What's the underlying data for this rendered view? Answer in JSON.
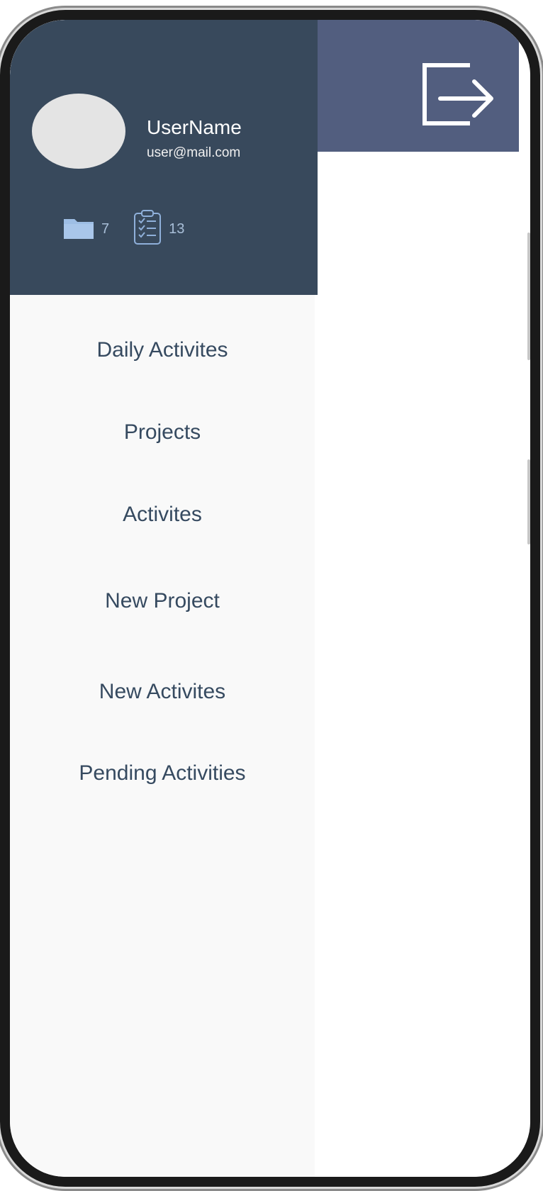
{
  "user": {
    "name": "UserName",
    "email": "user@mail.com"
  },
  "stats": {
    "projects_count": "7",
    "activities_count": "13"
  },
  "menu": {
    "items": [
      {
        "label": "Daily Activites"
      },
      {
        "label": "Projects"
      },
      {
        "label": "Activites"
      },
      {
        "label": "New Project"
      },
      {
        "label": "New Activites"
      },
      {
        "label": "Pending Activities"
      }
    ]
  },
  "icons": {
    "stats_projects": "folder-icon",
    "stats_activities": "clipboard-icon",
    "topbar_action": "logout-icon"
  },
  "colors": {
    "drawer_header": "#38495c",
    "drawer_background": "#f9f9f9",
    "topbar": "#525e7f",
    "menu_text": "#364a60",
    "stats_accent": "#a9bfd8",
    "avatar": "#e4e4e4"
  }
}
